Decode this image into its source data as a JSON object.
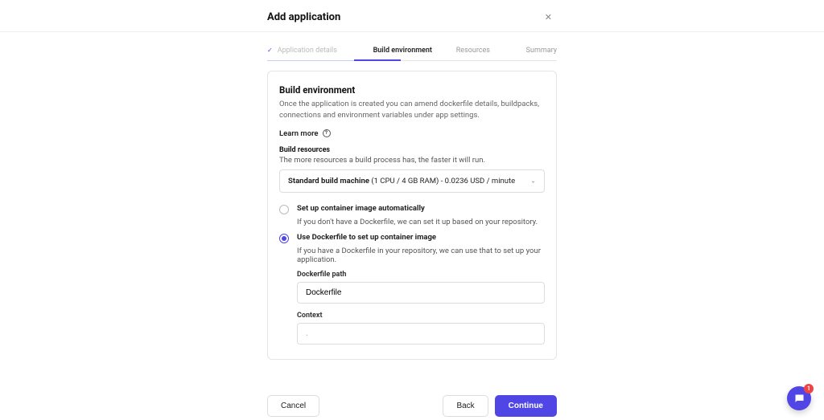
{
  "modal": {
    "title": "Add application"
  },
  "stepper": {
    "steps": [
      {
        "label": "Application details",
        "state": "done"
      },
      {
        "label": "Build environment",
        "state": "active"
      },
      {
        "label": "Resources",
        "state": "idle"
      },
      {
        "label": "Summary",
        "state": "idle"
      }
    ]
  },
  "section": {
    "title": "Build environment",
    "description": "Once the application is created you can amend dockerfile details, buildpacks, connections and environment variables under app settings.",
    "learn_more": "Learn more"
  },
  "build_resources": {
    "heading": "Build resources",
    "subtext": "The more resources a build process has, the faster it will run.",
    "select_bold": "Standard build machine",
    "select_rest": " (1 CPU / 4 GB RAM) - 0.0236 USD / minute"
  },
  "container_options": {
    "auto": {
      "label": "Set up container image automatically",
      "sub": "If you don't have a Dockerfile, we can set it up based on your repository."
    },
    "dockerfile": {
      "label": "Use Dockerfile to set up container image",
      "sub": "If you have a Dockerfile in your repository, we can use that to set up your application.",
      "path_label": "Dockerfile path",
      "path_value": "Dockerfile",
      "context_label": "Context",
      "context_value": "",
      "context_placeholder": "."
    }
  },
  "footer": {
    "cancel": "Cancel",
    "back": "Back",
    "continue": "Continue"
  },
  "chat": {
    "badge": "1"
  }
}
